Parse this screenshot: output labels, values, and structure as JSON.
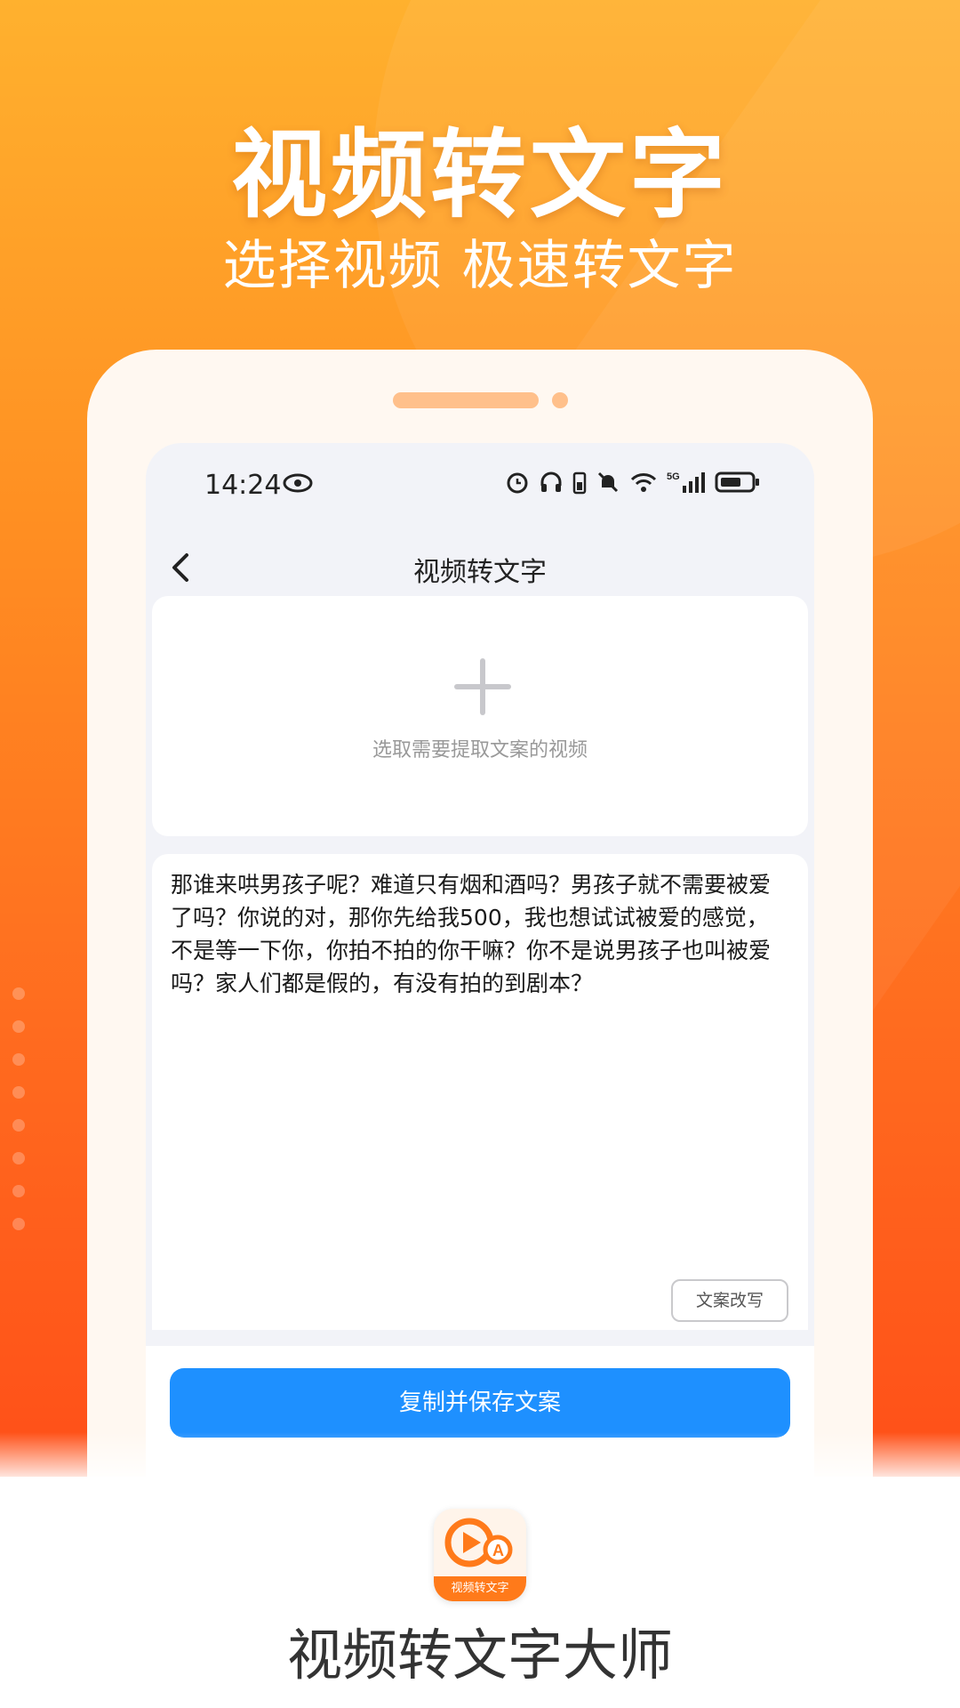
{
  "hero": {
    "title": "视频转文字",
    "subtitle": "选择视频 极速转文字"
  },
  "statusbar": {
    "time": "14:24",
    "icons": [
      "eye-icon",
      "alarm-icon",
      "headphones-icon",
      "battery-small-icon",
      "mute-bell-icon",
      "wifi-icon",
      "5g-signal-icon",
      "battery-icon"
    ]
  },
  "navbar": {
    "title": "视频转文字"
  },
  "picker": {
    "hint": "选取需要提取文案的视频"
  },
  "transcript": {
    "text": "那谁来哄男孩子呢？难道只有烟和酒吗？男孩子就不需要被爱了吗？你说的对，那你先给我500，我也想试试被爱的感觉，不是等一下你，你拍不拍的你干嘛？你不是说男孩子也叫被爱吗？家人们都是假的，有没有拍的到剧本？",
    "rewrite_label": "文案改写"
  },
  "actions": {
    "copy_label": "复制并保存文案",
    "copy_color": "#1e90ff"
  },
  "footer": {
    "icon_label": "视频转文字",
    "app_name": "视频转文字大师"
  },
  "colors": {
    "hero_top": "#ffb12e",
    "hero_bottom": "#ff4f18",
    "accent": "#ff7a1a"
  }
}
